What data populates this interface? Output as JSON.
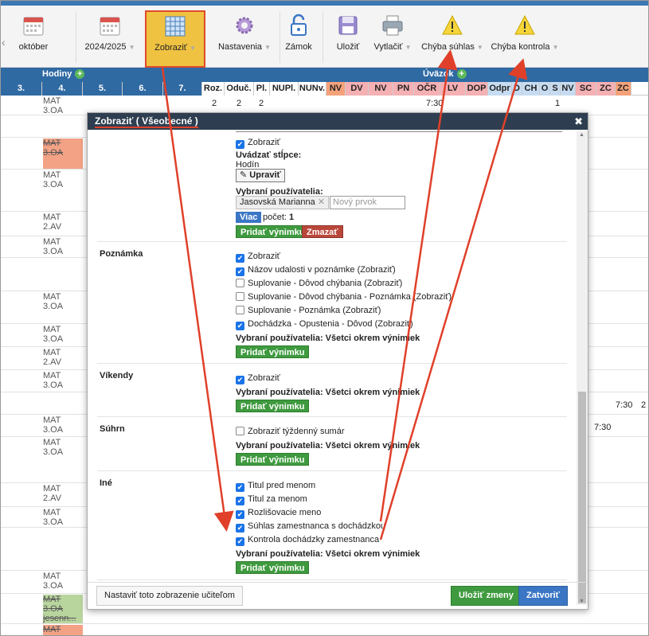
{
  "toolbar": {
    "month": "október",
    "year": "2024/2025",
    "zobrazit": "Zobraziť",
    "nastavenia": "Nastavenia",
    "zamok": "Zámok",
    "ulozit": "Uložiť",
    "vytlacit": "Vytlačiť",
    "chyba_suhlas": "Chýba súhlas",
    "chyba_kontrola": "Chýba kontrola"
  },
  "grid": {
    "hodiny": "Hodiny",
    "uvazok": "Úväzok",
    "hours": [
      "3.",
      "4.",
      "5.",
      "6.",
      "7."
    ],
    "cols": [
      {
        "label": "Roz.",
        "color": "#ffffff"
      },
      {
        "label": "Oduč.",
        "color": "#ffffff"
      },
      {
        "label": "Pl.",
        "color": "#ffffff"
      },
      {
        "label": "NUPl.",
        "color": "#ffffff"
      },
      {
        "label": "NUNv.",
        "color": "#ffffff"
      },
      {
        "label": "NV",
        "color": "#f5a27a"
      },
      {
        "label": "DV",
        "color": "#f5b0b4"
      },
      {
        "label": "NV",
        "color": "#f5b0b4"
      },
      {
        "label": "PN",
        "color": "#f5b0b4"
      },
      {
        "label": "OČR",
        "color": "#f5b0b4"
      },
      {
        "label": "LV",
        "color": "#f5b0b4"
      },
      {
        "label": "DOP",
        "color": "#f5b0b4"
      },
      {
        "label": "Odpr",
        "color": "#c6dcf2"
      },
      {
        "label": "D",
        "color": "#c6dcf2"
      },
      {
        "label": "CH",
        "color": "#c6dcf2"
      },
      {
        "label": "O",
        "color": "#c6dcf2"
      },
      {
        "label": "S",
        "color": "#c6dcf2"
      },
      {
        "label": "NV",
        "color": "#c6dcf2"
      },
      {
        "label": "SC",
        "color": "#f5b0b4"
      },
      {
        "label": "ZC",
        "color": "#f5b0b4"
      },
      {
        "label": "ZC",
        "color": "#f5a27a"
      }
    ],
    "first_row": {
      "roz": "2",
      "oduc": "2",
      "pl": "2",
      "ocr": "7:30",
      "o": "1"
    },
    "lessons": [
      {
        "line1": "MAT",
        "line2": "3.OA",
        "style": "normal"
      },
      {
        "line1": "MAT",
        "line2": "3.OA",
        "style": "red"
      },
      {
        "line1": "MAT",
        "line2": "3.OA",
        "style": "normal"
      },
      {
        "line1": "MAT",
        "line2": "2.AV",
        "style": "normal"
      },
      {
        "line1": "MAT",
        "line2": "3.OA",
        "style": "normal"
      },
      {
        "line1": "MAT",
        "line2": "3.OA",
        "style": "normal"
      },
      {
        "line1": "MAT",
        "line2": "3.OA",
        "style": "normal"
      },
      {
        "line1": "MAT",
        "line2": "2.AV",
        "style": "normal"
      },
      {
        "line1": "MAT",
        "line2": "3.OA",
        "style": "normal"
      },
      {
        "line1": "MAT",
        "line2": "3.OA",
        "style": "normal"
      },
      {
        "line1": "MAT",
        "line2": "3.OA",
        "style": "normal"
      },
      {
        "line1": "MAT",
        "line2": "2.AV",
        "style": "normal"
      },
      {
        "line1": "MAT",
        "line2": "3.OA",
        "style": "normal"
      },
      {
        "line1": "MAT",
        "line2": "3.OA",
        "style": "normal"
      },
      {
        "line1": "MAT",
        "line2": "3.OA",
        "extra": "jesenn...",
        "style": "green"
      },
      {
        "line1": "MAT",
        "line2": "",
        "style": "red"
      }
    ],
    "right_values": {
      "r1a": "7:30",
      "r1b": "2",
      "r2": "7:30"
    }
  },
  "modal": {
    "title": "Zobraziť ( Všeobecné )",
    "top_block": {
      "zobrazit": "Zobraziť",
      "stlpce_label": "Uvádzať stĺpce:",
      "stlpce_value": "Hodín",
      "upravit": "Upraviť",
      "users_label": "Vybraní používatelia:",
      "user_tag": "Jasovská Marianna",
      "new_placeholder": "Nový prvok",
      "viac": "Viac",
      "pocet_label": "počet:",
      "pocet_value": "1",
      "pridat": "Pridať výnimku",
      "zmazat": "Zmazať"
    },
    "sections": {
      "poznamka": {
        "title": "Poznámka",
        "items": [
          {
            "label": "Zobraziť",
            "checked": true
          },
          {
            "label": "Názov udalosti v poznámke (Zobraziť)",
            "checked": true
          },
          {
            "label": "Suplovanie - Dôvod chýbania (Zobraziť)",
            "checked": false
          },
          {
            "label": "Suplovanie - Dôvod chýbania - Poznámka (Zobraziť)",
            "checked": false
          },
          {
            "label": "Suplovanie - Poznámka (Zobraziť)",
            "checked": false
          },
          {
            "label": "Dochádzka - Opustenia - Dôvod (Zobraziť)",
            "checked": true
          }
        ],
        "users": "Vybraní používatelia: Všetci okrem výnimiek",
        "pridat": "Pridať výnimku"
      },
      "vikendy": {
        "title": "Víkendy",
        "items": [
          {
            "label": "Zobraziť",
            "checked": true
          }
        ],
        "users": "Vybraní používatelia: Všetci okrem výnimiek",
        "pridat": "Pridať výnimku"
      },
      "suhrn": {
        "title": "Súhrn",
        "items": [
          {
            "label": "Zobraziť týždenný sumár",
            "checked": false
          }
        ],
        "users": "Vybraní používatelia: Všetci okrem výnimiek",
        "pridat": "Pridať výnimku"
      },
      "ine": {
        "title": "Iné",
        "items": [
          {
            "label": "Titul pred menom",
            "checked": true
          },
          {
            "label": "Titul za menom",
            "checked": true
          },
          {
            "label": "Rozlišovacie meno",
            "checked": true
          },
          {
            "label": "Súhlas zamestnanca s dochádzkou",
            "checked": true
          },
          {
            "label": "Kontrola dochádzky zamestnanca",
            "checked": true
          }
        ],
        "users": "Vybraní používatelia: Všetci okrem výnimiek",
        "pridat": "Pridať výnimku"
      }
    },
    "footer": {
      "nastavit": "Nastaviť toto zobrazenie učiteľom",
      "ulozit": "Uložiť zmeny",
      "zatvorit": "Zatvoriť"
    }
  },
  "colors": {
    "toolbar_accent": "#3c78b4",
    "highlight": "#f0c242",
    "annotation_red": "#e0402a",
    "green_button": "#3f9a3f",
    "blue_button": "#3a76c4"
  }
}
